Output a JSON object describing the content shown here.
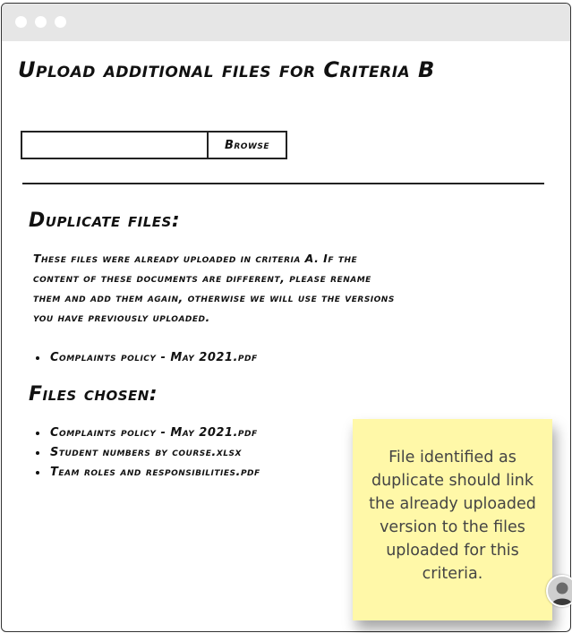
{
  "window": {
    "controls": [
      "close",
      "minimize",
      "maximize"
    ]
  },
  "page": {
    "title": "Upload additional files for Criteria B"
  },
  "upload": {
    "file_input_value": "",
    "browse_label": "Browse"
  },
  "duplicates": {
    "heading": "Duplicate files:",
    "message": "These files were already uploaded in criteria A. If the content of these documents are different, please rename them and add them again, otherwise we will use the versions you have previously uploaded.",
    "files": [
      "Complaints policy - May 2021.pdf"
    ]
  },
  "chosen": {
    "heading": "Files chosen:",
    "files": [
      "Complaints policy - May 2021.pdf",
      "Student numbers by course.xlsx",
      "Team roles and responsibilities.pdf"
    ]
  },
  "annotation": {
    "sticky_note": "File identified as duplicate should link the already uploaded version to the files uploaded for this criteria.",
    "sticky_color": "#fff8a8"
  },
  "avatar": {
    "icon": "user-avatar-icon"
  }
}
